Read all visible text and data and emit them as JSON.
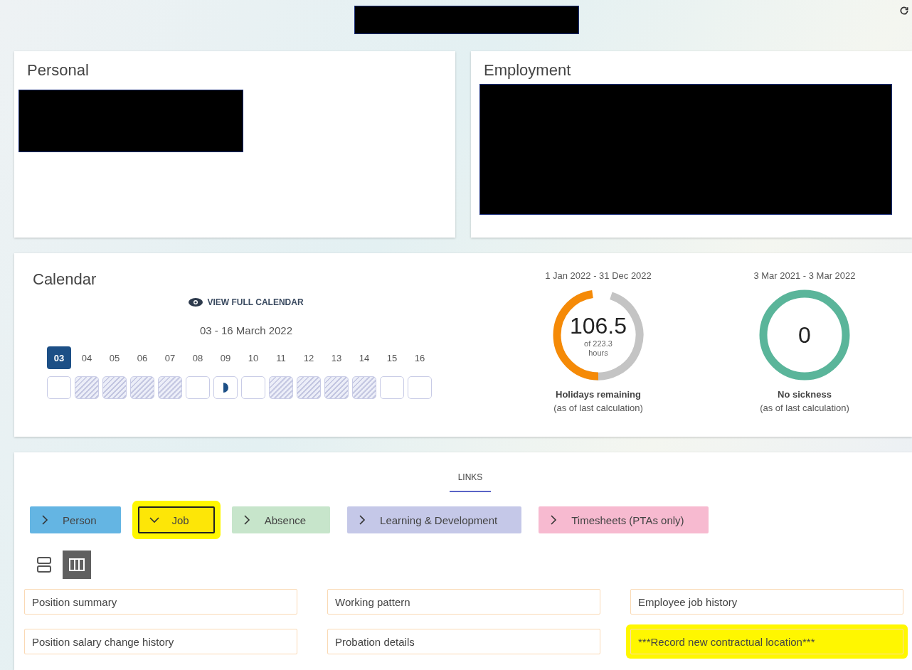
{
  "personal": {
    "title": "Personal"
  },
  "employment": {
    "title": "Employment"
  },
  "calendar": {
    "title": "Calendar",
    "view_link": "VIEW FULL CALENDAR",
    "range": "03 - 16 March 2022",
    "days": [
      {
        "label": "03",
        "selected": true,
        "kind": "empty"
      },
      {
        "label": "04",
        "selected": false,
        "kind": "leave"
      },
      {
        "label": "05",
        "selected": false,
        "kind": "leave"
      },
      {
        "label": "06",
        "selected": false,
        "kind": "leave"
      },
      {
        "label": "07",
        "selected": false,
        "kind": "leave"
      },
      {
        "label": "08",
        "selected": false,
        "kind": "empty"
      },
      {
        "label": "09",
        "selected": false,
        "kind": "half"
      },
      {
        "label": "10",
        "selected": false,
        "kind": "empty"
      },
      {
        "label": "11",
        "selected": false,
        "kind": "leave"
      },
      {
        "label": "12",
        "selected": false,
        "kind": "leave"
      },
      {
        "label": "13",
        "selected": false,
        "kind": "leave"
      },
      {
        "label": "14",
        "selected": false,
        "kind": "leave"
      },
      {
        "label": "15",
        "selected": false,
        "kind": "empty"
      },
      {
        "label": "16",
        "selected": false,
        "kind": "empty"
      }
    ],
    "gauges": [
      {
        "period": "1 Jan 2022 - 31 Dec 2022",
        "value": "106.5",
        "of": "of 223.3",
        "unit": "hours",
        "level": 0.477,
        "color": "#f58a07",
        "label": "Holidays remaining",
        "note": "(as of last calculation)"
      },
      {
        "period": "3 Mar 2021 - 3 Mar 2022",
        "value": "0",
        "level": 1,
        "color": "#5ab59a",
        "label": "No sickness",
        "note": "(as of last calculation)"
      }
    ]
  },
  "links": {
    "heading": "LINKS",
    "categories": [
      {
        "label": "Person",
        "color": "#64b5e3",
        "expanded": false,
        "highlighted": false
      },
      {
        "label": "Job",
        "color": "#fde607",
        "expanded": true,
        "highlighted": true
      },
      {
        "label": "Absence",
        "color": "#c7e5cb",
        "expanded": false,
        "highlighted": false
      },
      {
        "label": "Learning & Development",
        "color": "#c5c8e8",
        "expanded": false,
        "highlighted": false
      },
      {
        "label": "Timesheets (PTAs only)",
        "color": "#f7bad0",
        "expanded": false,
        "highlighted": false
      }
    ],
    "views": [
      {
        "kind": "rows",
        "selected": false
      },
      {
        "kind": "columns",
        "selected": true
      }
    ],
    "items": [
      {
        "label": "Position summary",
        "highlighted": false
      },
      {
        "label": "Working pattern",
        "highlighted": false
      },
      {
        "label": "Employee job history",
        "highlighted": false
      },
      {
        "label": "Position salary change history",
        "highlighted": false
      },
      {
        "label": "Probation details",
        "highlighted": false
      },
      {
        "label": "***Record new contractual location***",
        "highlighted": true
      }
    ]
  }
}
